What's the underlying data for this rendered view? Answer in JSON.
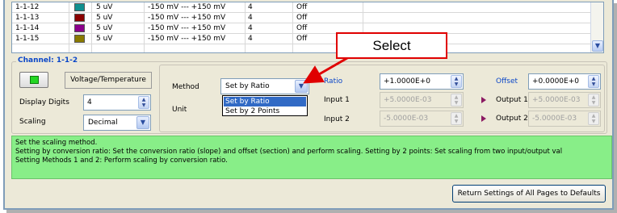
{
  "table": {
    "rows": [
      {
        "channel": "1-1-12",
        "color": "#0f8f8f",
        "resolution": "5 uV",
        "range": "-150 mV  ---  +150 mV",
        "filter": "4",
        "state": "Off"
      },
      {
        "channel": "1-1-13",
        "color": "#8b0000",
        "resolution": "5 uV",
        "range": "-150 mV  ---  +150 mV",
        "filter": "4",
        "state": "Off"
      },
      {
        "channel": "1-1-14",
        "color": "#8b008b",
        "resolution": "5 uV",
        "range": "-150 mV  ---  +150 mV",
        "filter": "4",
        "state": "Off"
      },
      {
        "channel": "1-1-15",
        "color": "#8a7a00",
        "resolution": "5 uV",
        "range": "-150 mV  ---  +150 mV",
        "filter": "4",
        "state": "Off"
      }
    ]
  },
  "callout": {
    "text": "Select",
    "color": "#e00000"
  },
  "channel": {
    "title": "Channel: 1-1-2",
    "type_label": "Voltage/Temperature",
    "display_digits_label": "Display Digits",
    "display_digits_value": "4",
    "scaling_label": "Scaling",
    "scaling_value": "Decimal",
    "method_label": "Method",
    "method_value": "Set by Ratio",
    "method_options": [
      "Set by Ratio",
      "Set by 2 Points"
    ],
    "unit_label": "Unit",
    "ratio_label": "Ratio",
    "ratio_value": "+1.0000E+0",
    "offset_label": "Offset",
    "offset_value": "+0.0000E+0",
    "input1_label": "Input 1",
    "input1_value": "+5.0000E-03",
    "input2_label": "Input 2",
    "input2_value": "-5.0000E-03",
    "output1_label": "Output 1",
    "output1_value": "+5.0000E-03",
    "output2_label": "Output 2",
    "output2_value": "-5.0000E-03"
  },
  "help": {
    "line1": "Set the scaling method.",
    "line2": "Setting by conversion ratio: Set the conversion ratio (slope) and offset (section) and perform scaling.  Setting by 2 points: Set scaling from two input/output val",
    "line3": "Setting Methods 1 and 2: Perform scaling by conversion ratio.",
    "background": "#88ee88"
  },
  "footer": {
    "return_label": "Return Settings of All Pages to Defaults"
  },
  "icons": {
    "spin": "spin-arrows-icon",
    "dropdown": "chevron-down-icon",
    "pointer": "triangle-right-icon",
    "scroll": "scroll-down-icon"
  }
}
